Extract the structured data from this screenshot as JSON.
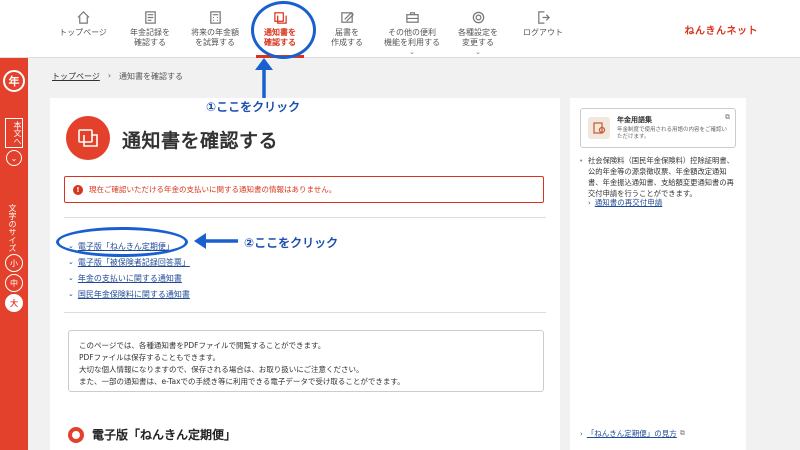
{
  "nav": {
    "items": [
      {
        "label": "トップページ",
        "icon": "home-icon",
        "active": false,
        "dropdown": false
      },
      {
        "label": "年金記録を\n確認する",
        "icon": "document-icon",
        "active": false,
        "dropdown": false
      },
      {
        "label": "将来の年金額\nを試算する",
        "icon": "calculator-icon",
        "active": false,
        "dropdown": false
      },
      {
        "label": "通知書を\n確認する",
        "icon": "notice-icon",
        "active": true,
        "dropdown": false
      },
      {
        "label": "届書を\n作成する",
        "icon": "form-icon",
        "active": false,
        "dropdown": false
      },
      {
        "label": "その他の便利\n機能を利用する",
        "icon": "toolbox-icon",
        "active": false,
        "dropdown": true
      },
      {
        "label": "各種設定を\n変更する",
        "icon": "gear-icon",
        "active": false,
        "dropdown": true
      },
      {
        "label": "ログアウト",
        "icon": "logout-icon",
        "active": false,
        "dropdown": false
      }
    ],
    "brand": "ねんきんネット"
  },
  "leftbar": {
    "seal": "年",
    "honbun": "本文へ",
    "fontsize_label": "文字のサイズ",
    "fontsizes": [
      "小",
      "中",
      "大"
    ]
  },
  "breadcrumb": {
    "home": "トップページ",
    "separator": "›",
    "current": "通知書を確認する"
  },
  "main": {
    "title": "通知書を確認する",
    "alert": "現在ご確認いただける年金の支払いに関する通知書の情報はありません。",
    "links": [
      "電子版「ねんきん定期便」",
      "電子版「被保険者記録回答票」",
      "年金の支払いに関する通知書",
      "国民年金保険料に関する通知書"
    ],
    "info": [
      "このページでは、各種通知書をPDFファイルで閲覧することができます。",
      "PDFファイルは保存することもできます。",
      "大切な個人情報になりますので、保存される場合は、お取り扱いにご注意ください。",
      "また、一部の通知書は、e-Taxでの手続き等に利用できる電子データで受け取ることができます。"
    ],
    "section_title": "電子版「ねんきん定期便」"
  },
  "sidebar": {
    "glossary_title": "年金用語集",
    "glossary_desc": "年金制度で使用される用語の内容をご確認いただけます。",
    "bullet": "社会保険料（国民年金保険料）控除証明書、公的年金等の源泉徴収票、年金額改定通知書、年金振込通知書、支給額変更通知書の再交付申請を行うことができます。",
    "link": "通知書の再交付申請",
    "bottom_link": "「ねんきん定期便」の見方"
  },
  "annotations": {
    "step1": "①ここをクリック",
    "step2": "②ここをクリック",
    "color": "#1a5fd0"
  },
  "colors": {
    "accent": "#e4412c",
    "link": "#1e4a96"
  }
}
